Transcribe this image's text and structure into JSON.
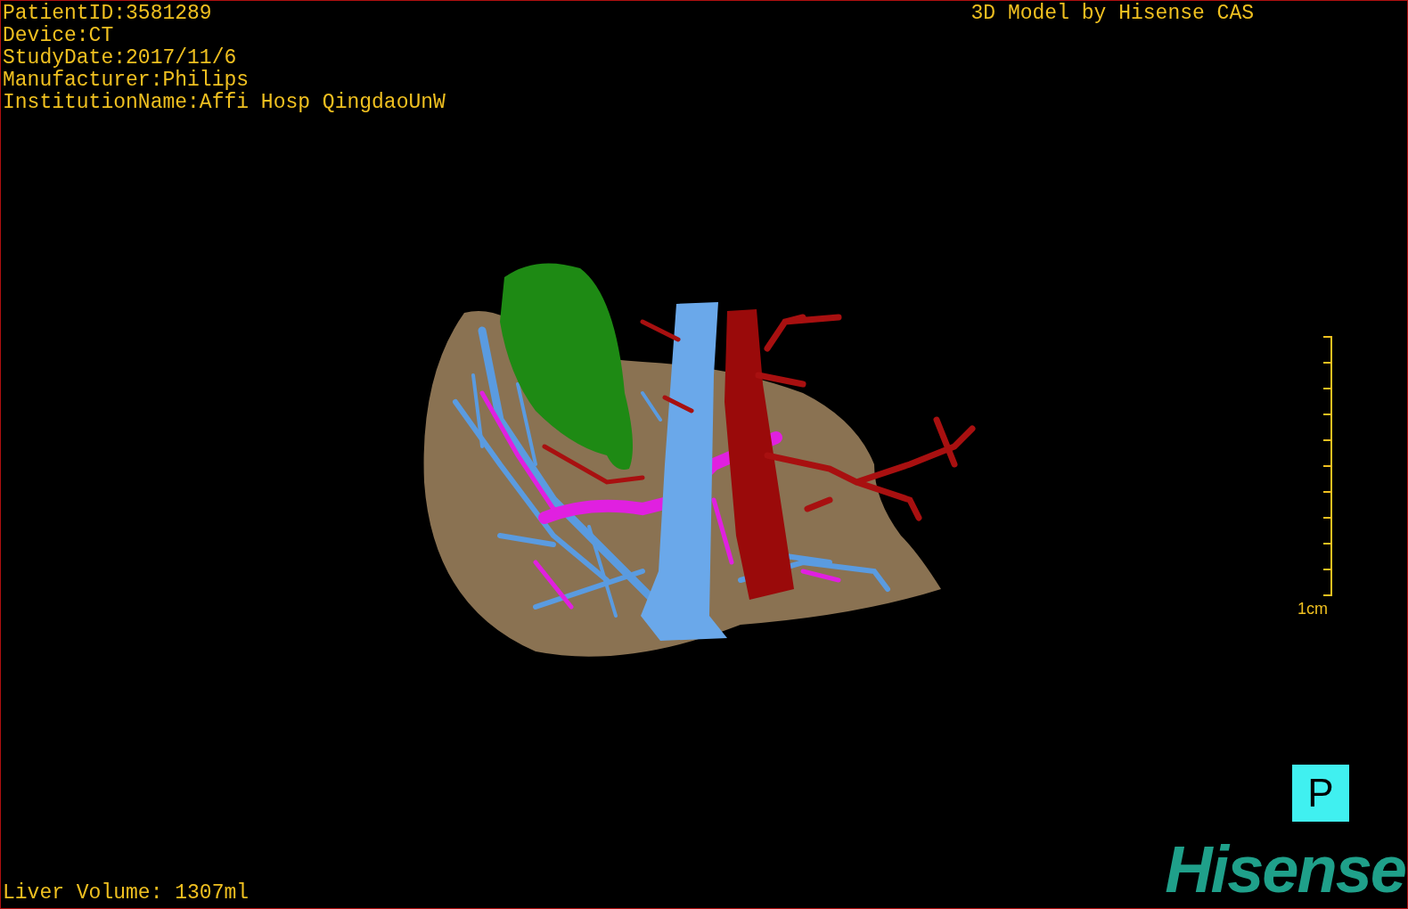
{
  "patient_info": [
    "PatientID:3581289",
    "Device:CT",
    "StudyDate:2017/11/6",
    "Manufacturer:Philips",
    "InstitutionName:Affi Hosp QingdaoUnW"
  ],
  "model_caption": "3D Model by Hisense CAS",
  "scale_bar": {
    "label": "1cm"
  },
  "orientation_marker": "P",
  "volume": "Liver Volume: 1307ml",
  "logo": "Hisense"
}
